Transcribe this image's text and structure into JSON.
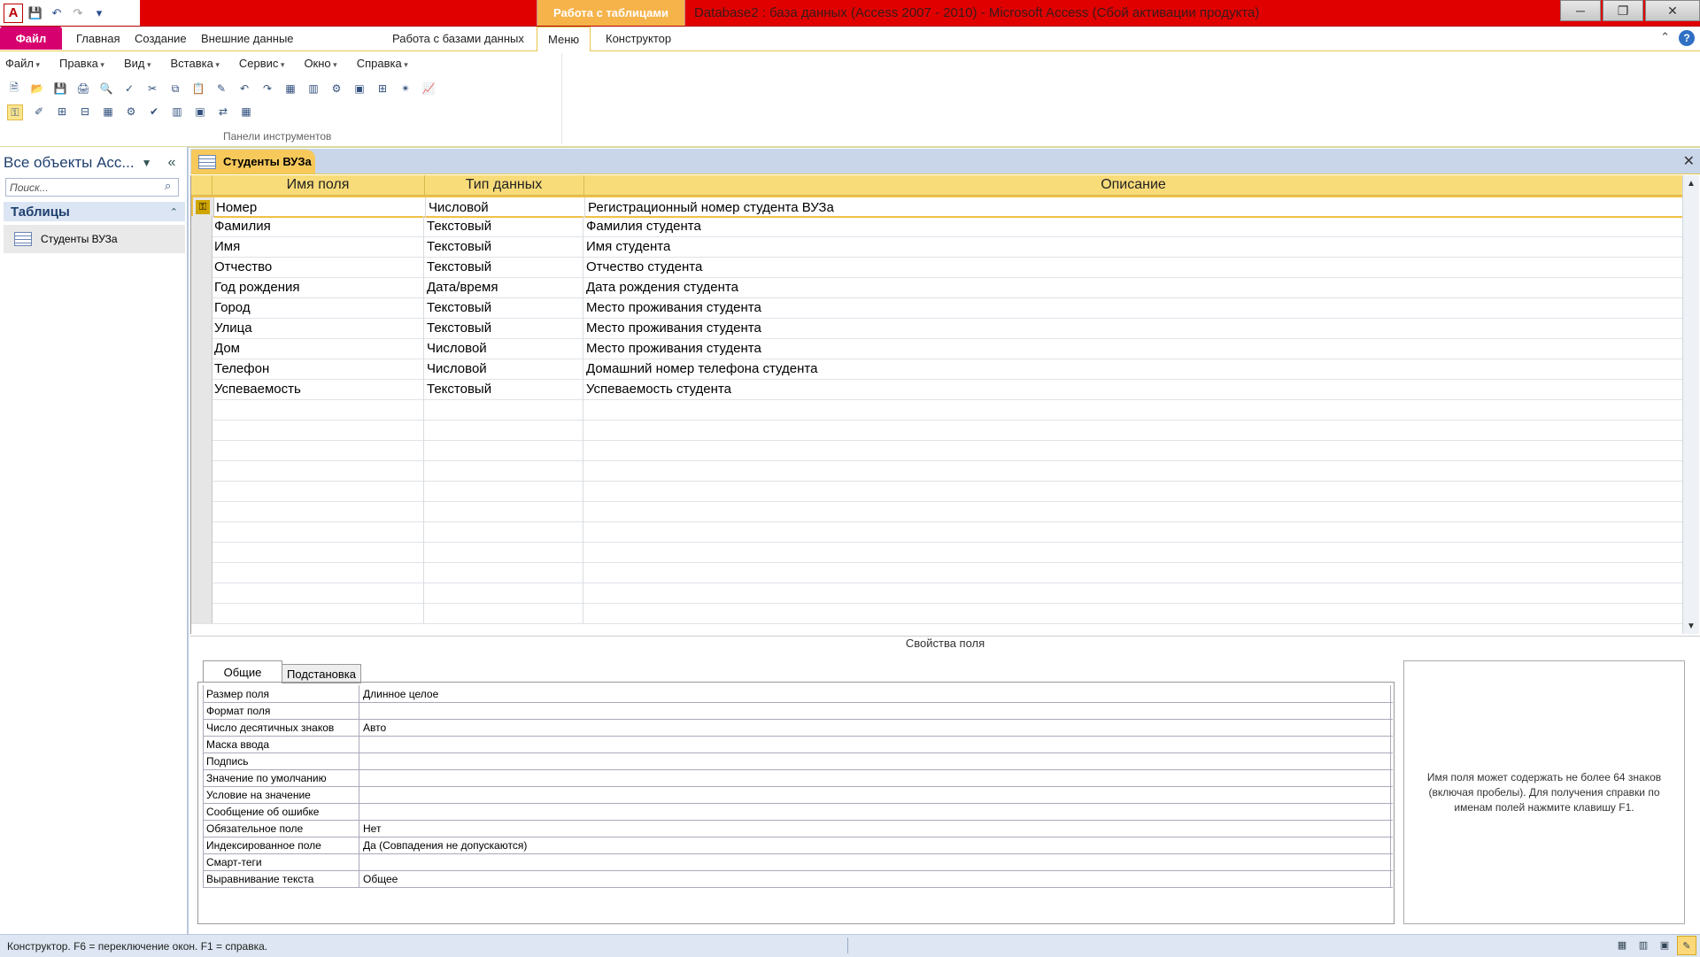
{
  "window": {
    "context_tab": "Работа с таблицами",
    "title": "Database2 : база данных (Access 2007 - 2010)  -  Microsoft Access (Сбой активации продукта)"
  },
  "ribbon": {
    "tabs": [
      "Файл",
      "Главная",
      "Создание",
      "Внешние данные",
      "Работа с базами данных",
      "Меню",
      "Конструктор"
    ],
    "active_tab": "Меню",
    "menubar": [
      "Файл",
      "Правка",
      "Вид",
      "Вставка",
      "Сервис",
      "Окно",
      "Справка"
    ],
    "group_label": "Панели инструментов"
  },
  "nav": {
    "title": "Все объекты Acc...",
    "search_placeholder": "Поиск...",
    "group": "Таблицы",
    "item": "Студенты ВУЗа"
  },
  "document": {
    "tab": "Студенты ВУЗа",
    "headers": [
      "Имя поля",
      "Тип данных",
      "Описание"
    ],
    "rows": [
      [
        "Номер",
        "Числовой",
        "Регистрационный номер студента ВУЗа"
      ],
      [
        "Фамилия",
        "Текстовый",
        "Фамилия студента"
      ],
      [
        "Имя",
        "Текстовый",
        "Имя студента"
      ],
      [
        "Отчество",
        "Текстовый",
        "Отчество студента"
      ],
      [
        "Год рождения",
        "Дата/время",
        "Дата рождения студента"
      ],
      [
        "Город",
        "Текстовый",
        "Место проживания студента"
      ],
      [
        "Улица",
        "Текстовый",
        "Место проживания студента"
      ],
      [
        "Дом",
        "Числовой",
        "Место проживания студента"
      ],
      [
        "Телефон",
        "Числовой",
        "Домашний номер телефона студента"
      ],
      [
        "Успеваемость",
        "Текстовый",
        "Успеваемость студента"
      ]
    ]
  },
  "properties": {
    "label": "Свойства поля",
    "tab_general": "Общие",
    "tab_lookup": "Подстановка",
    "rows": [
      [
        "Размер поля",
        "Длинное целое"
      ],
      [
        "Формат поля",
        ""
      ],
      [
        "Число десятичных знаков",
        "Авто"
      ],
      [
        "Маска ввода",
        ""
      ],
      [
        "Подпись",
        ""
      ],
      [
        "Значение по умолчанию",
        ""
      ],
      [
        "Условие на значение",
        ""
      ],
      [
        "Сообщение об ошибке",
        ""
      ],
      [
        "Обязательное поле",
        "Нет"
      ],
      [
        "Индексированное поле",
        "Да (Совпадения не допускаются)"
      ],
      [
        "Смарт-теги",
        ""
      ],
      [
        "Выравнивание текста",
        "Общее"
      ]
    ],
    "help": "Имя поля может содержать не более 64 знаков (включая пробелы). Для получения справки по именам полей нажмите клавишу F1."
  },
  "status": {
    "text": "Конструктор.  F6 = переключение окон.  F1 = справка."
  }
}
